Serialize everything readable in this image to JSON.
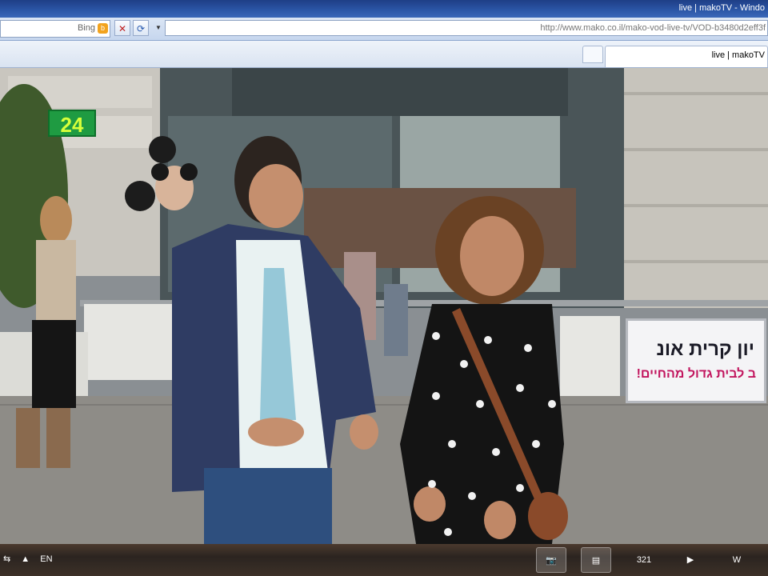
{
  "window": {
    "title": "live | makoTV - Windo"
  },
  "addressbar": {
    "search_label": "Bing",
    "url": "http://www.mako.co.il/mako-vod-live-tv/VOD-b3480d2eff3f"
  },
  "tabs": [
    {
      "label": "live | makoTV"
    }
  ],
  "video": {
    "channel_logo": "24",
    "banner": {
      "line1": "יון קרית אונ",
      "line2": "ב לבית גדול מהחיים!"
    }
  },
  "taskbar": {
    "language": "EN",
    "icons": [
      "camera-app-icon",
      "notes-icon",
      "media-player-icon",
      "video-player-icon",
      "word-icon"
    ],
    "media_player_label": "321"
  },
  "colors": {
    "titlebar": "#2c57a8",
    "banner_accent": "#c2155e",
    "channel_logo": "#1f9b42"
  }
}
